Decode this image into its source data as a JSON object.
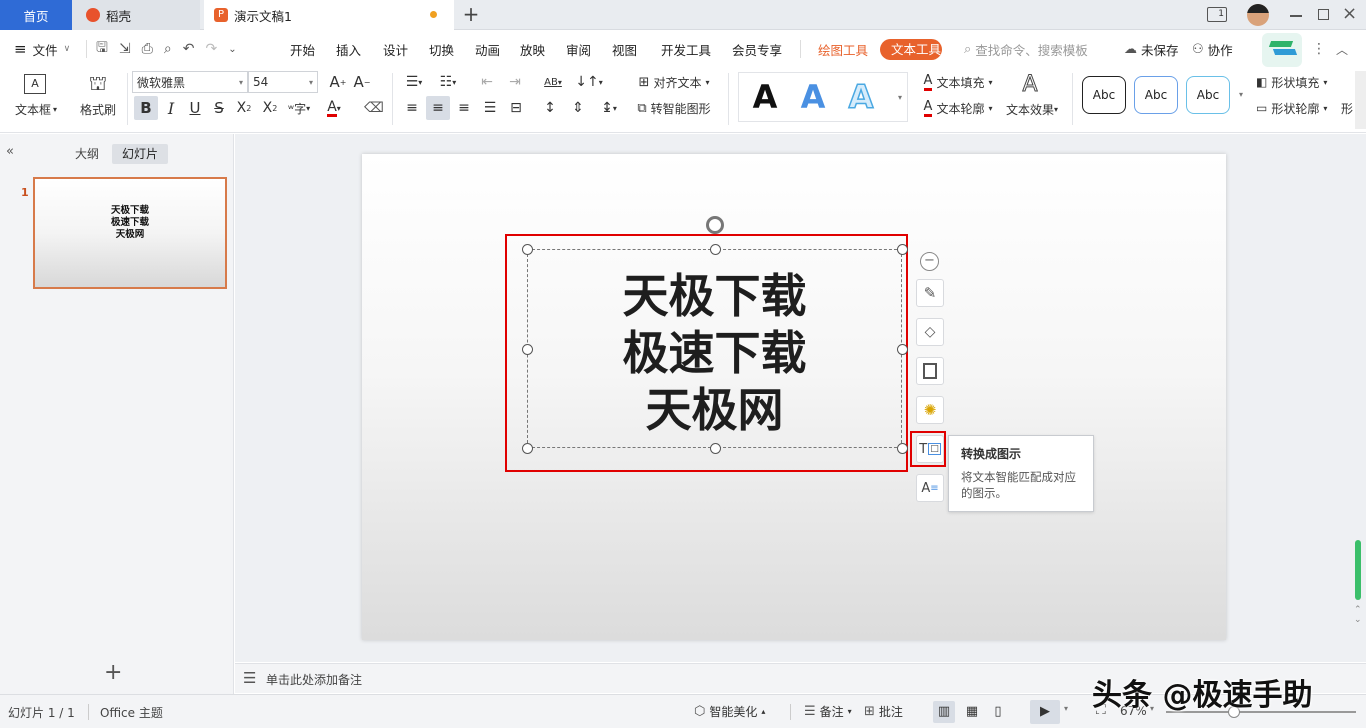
{
  "tabs": {
    "home": "首页",
    "daoke": "稻壳",
    "doc": "演示文稿1"
  },
  "menu": {
    "file": "文件",
    "items": [
      "开始",
      "插入",
      "设计",
      "切换",
      "动画",
      "放映",
      "审阅",
      "视图",
      "开发工具",
      "会员专享"
    ],
    "drawing_tools": "绘图工具",
    "text_tools": "文本工具",
    "search_placeholder": "查找命令、搜索模板",
    "unsaved": "未保存",
    "collab": "协作"
  },
  "ribbon": {
    "textbox": "文本框",
    "format_painter": "格式刷",
    "font_name": "微软雅黑",
    "font_size": "54",
    "align_text": "对齐文本",
    "smart_shape": "转智能图形",
    "style_letter": "A",
    "text_fill": "文本填充",
    "text_outline": "文本轮廓",
    "text_effect": "文本效果",
    "abc": "Abc",
    "shape_fill": "形状填充",
    "shape_outline": "形状轮廓",
    "more": "形"
  },
  "left_panel": {
    "outline_tab": "大纲",
    "slides_tab": "幻灯片",
    "slide_number": "1",
    "thumb_lines": [
      "天极下载",
      "极速下载",
      "天极网"
    ]
  },
  "slide": {
    "lines": [
      "天极下载",
      "极速下载",
      "天极网"
    ]
  },
  "tooltip": {
    "title": "转换成图示",
    "body": "将文本智能匹配成对应的图示。"
  },
  "notes": {
    "placeholder": "单击此处添加备注"
  },
  "status": {
    "slide_info": "幻灯片 1 / 1",
    "theme": "Office 主题",
    "beautify": "智能美化",
    "notes": "备注",
    "comment": "批注",
    "zoom": "67%"
  },
  "watermark": "头条 @极速手助",
  "colors": {
    "accent_blue": "#2f6bd6",
    "orange": "#e8622c",
    "highlight_red": "#e00000"
  }
}
